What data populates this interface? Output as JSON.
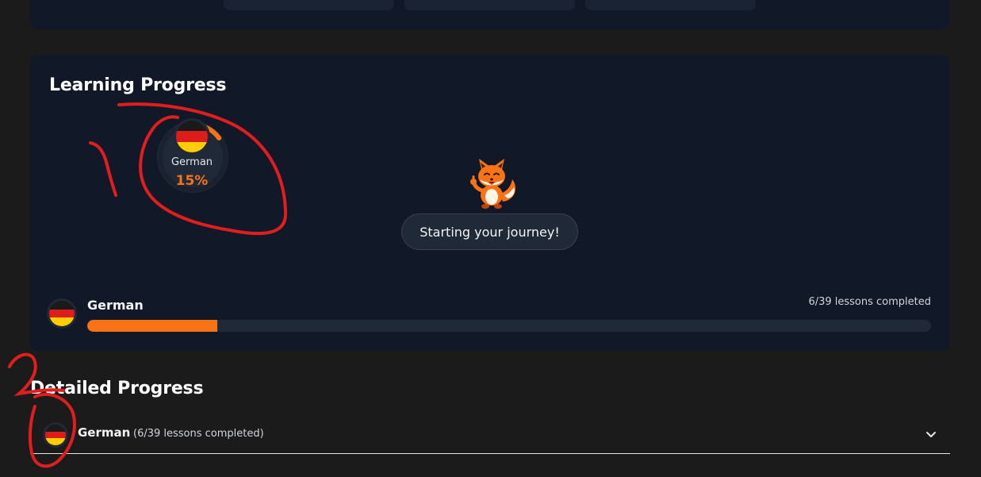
{
  "colors": {
    "background": "#1b1b1b",
    "card": "#111827",
    "accent": "#f97316",
    "track": "#1f2937",
    "annotation": "#e11d1d"
  },
  "learning_progress": {
    "title": "Learning Progress",
    "ring": {
      "language": "German",
      "percent_label": "15%",
      "progress": 0.15,
      "flag_icon": "german-flag-icon"
    },
    "mascot": {
      "icon": "fox-thumbs-up-icon",
      "message": "Starting your journey!"
    },
    "language_row": {
      "language": "German",
      "lessons_label": "6/39 lessons completed",
      "progress": 0.1538
    }
  },
  "detailed_progress": {
    "title": "Detailed Progress",
    "items": [
      {
        "language": "German",
        "count_label": "(6/39 lessons completed)",
        "expand_icon": "chevron-down-icon"
      }
    ]
  },
  "annotations": {
    "mark_1": "1",
    "mark_2": "2"
  }
}
